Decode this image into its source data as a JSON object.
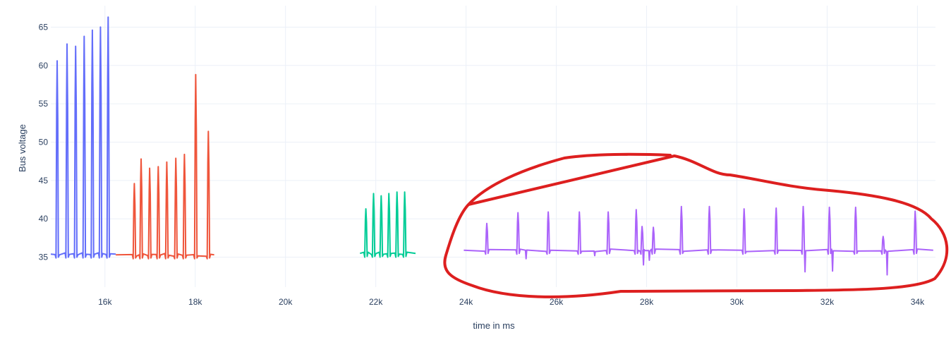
{
  "chart_data": {
    "type": "line",
    "xlabel": "time in ms",
    "ylabel": "Bus voltage",
    "xlim": [
      14800,
      34400
    ],
    "ylim": [
      31.1,
      67.8
    ],
    "x_ticks": [
      {
        "value": 16000,
        "label": "16k"
      },
      {
        "value": 18000,
        "label": "18k"
      },
      {
        "value": 20000,
        "label": "20k"
      },
      {
        "value": 22000,
        "label": "22k"
      },
      {
        "value": 24000,
        "label": "24k"
      },
      {
        "value": 26000,
        "label": "26k"
      },
      {
        "value": 28000,
        "label": "28k"
      },
      {
        "value": 30000,
        "label": "30k"
      },
      {
        "value": 32000,
        "label": "32k"
      },
      {
        "value": 34000,
        "label": "34k"
      }
    ],
    "y_ticks": [
      {
        "value": 35,
        "label": "35"
      },
      {
        "value": 40,
        "label": "40"
      },
      {
        "value": 45,
        "label": "45"
      },
      {
        "value": 50,
        "label": "50"
      },
      {
        "value": 55,
        "label": "55"
      },
      {
        "value": 60,
        "label": "60"
      },
      {
        "value": 65,
        "label": "65"
      }
    ],
    "grid": true,
    "legend": "none",
    "series": [
      {
        "color": "#636efa",
        "baseline": 35.4,
        "x_range": [
          14800,
          16240
        ],
        "peaks": [
          {
            "x": 14940,
            "y": 60.6
          },
          {
            "x": 15160,
            "y": 62.8
          },
          {
            "x": 15350,
            "y": 62.5
          },
          {
            "x": 15540,
            "y": 63.8
          },
          {
            "x": 15720,
            "y": 64.6
          },
          {
            "x": 15900,
            "y": 65.0
          },
          {
            "x": 16070,
            "y": 66.3
          }
        ]
      },
      {
        "color": "#ef553b",
        "baseline": 35.3,
        "x_range": [
          16240,
          18420
        ],
        "peaks": [
          {
            "x": 16650,
            "y": 44.6
          },
          {
            "x": 16800,
            "y": 47.8
          },
          {
            "x": 16990,
            "y": 46.6
          },
          {
            "x": 17180,
            "y": 46.8
          },
          {
            "x": 17370,
            "y": 47.4
          },
          {
            "x": 17570,
            "y": 47.9
          },
          {
            "x": 17760,
            "y": 48.4
          },
          {
            "x": 18010,
            "y": 58.8
          },
          {
            "x": 18290,
            "y": 51.4
          }
        ]
      },
      {
        "color": "#00cc96",
        "baseline": 35.5,
        "x_range": [
          21650,
          22880
        ],
        "peaks": [
          {
            "x": 21780,
            "y": 41.3
          },
          {
            "x": 21950,
            "y": 43.3
          },
          {
            "x": 22120,
            "y": 43.0
          },
          {
            "x": 22290,
            "y": 43.3
          },
          {
            "x": 22470,
            "y": 43.5
          },
          {
            "x": 22640,
            "y": 43.5
          }
        ]
      },
      {
        "color": "#ab63fa",
        "baseline": 35.9,
        "x_range": [
          23950,
          34350
        ],
        "peaks": [
          {
            "x": 24460,
            "y": 39.4
          },
          {
            "x": 25150,
            "y": 40.8
          },
          {
            "x": 25820,
            "y": 40.9
          },
          {
            "x": 26510,
            "y": 40.9
          },
          {
            "x": 27150,
            "y": 40.9
          },
          {
            "x": 27770,
            "y": 41.2
          },
          {
            "x": 27900,
            "y": 39.0
          },
          {
            "x": 28150,
            "y": 38.9
          },
          {
            "x": 28770,
            "y": 41.6
          },
          {
            "x": 29390,
            "y": 41.6
          },
          {
            "x": 30160,
            "y": 41.3
          },
          {
            "x": 30870,
            "y": 41.4
          },
          {
            "x": 31470,
            "y": 41.6
          },
          {
            "x": 32050,
            "y": 41.5
          },
          {
            "x": 32630,
            "y": 41.5
          },
          {
            "x": 33240,
            "y": 37.7
          },
          {
            "x": 33950,
            "y": 41.0
          }
        ],
        "dips": [
          {
            "x": 25330,
            "y": 34.8
          },
          {
            "x": 26850,
            "y": 35.2
          },
          {
            "x": 27930,
            "y": 34.0
          },
          {
            "x": 28060,
            "y": 34.6
          },
          {
            "x": 31510,
            "y": 33.1
          },
          {
            "x": 32120,
            "y": 33.2
          },
          {
            "x": 33330,
            "y": 32.7
          }
        ]
      }
    ],
    "annotation": {
      "shape": "freehand loop",
      "color": "#dd1f1f",
      "x_range": [
        23800,
        34500
      ],
      "y_range": [
        31.7,
        48.4
      ]
    }
  }
}
